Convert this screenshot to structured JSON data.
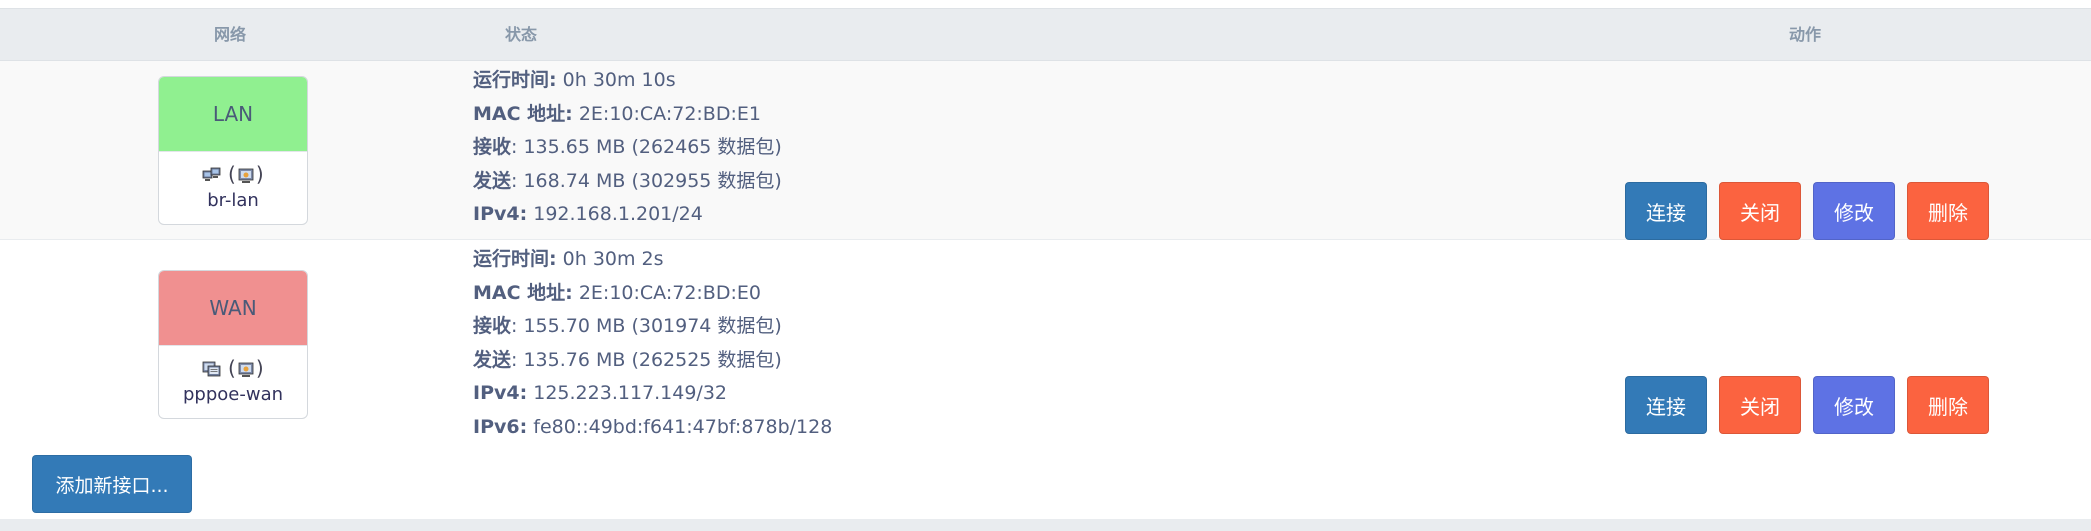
{
  "table": {
    "headers": {
      "network": "网络",
      "status": "状态",
      "actions": "动作"
    }
  },
  "interfaces": [
    {
      "name": "LAN",
      "device": "br-lan",
      "head_color": "#90f090",
      "device_icons": [
        "ethernet-bridge-icon",
        "wireless-icon"
      ],
      "status": {
        "uptime_label": "运行时间:",
        "uptime_value": "0h 30m 10s",
        "mac_label": "MAC 地址:",
        "mac_value": "2E:10:CA:72:BD:E1",
        "rx_label": "接收",
        "rx_value": ": 135.65 MB (262465 数据包)",
        "tx_label": "发送",
        "tx_value": ": 168.74 MB (302955 数据包)",
        "ipv4_label": "IPv4:",
        "ipv4_value": "192.168.1.201/24"
      },
      "buttons": {
        "connect": "连接",
        "stop": "关闭",
        "edit": "修改",
        "delete": "删除"
      }
    },
    {
      "name": "WAN",
      "device": "pppoe-wan",
      "head_color": "#f09090",
      "device_icons": [
        "tunnel-icon",
        "wireless-icon"
      ],
      "status": {
        "uptime_label": "运行时间:",
        "uptime_value": "0h 30m 2s",
        "mac_label": "MAC 地址:",
        "mac_value": "2E:10:CA:72:BD:E0",
        "rx_label": "接收",
        "rx_value": ": 155.70 MB (301974 数据包)",
        "tx_label": "发送",
        "tx_value": ": 135.76 MB (262525 数据包)",
        "ipv4_label": "IPv4:",
        "ipv4_value": "125.223.117.149/32",
        "ipv6_label": "IPv6:",
        "ipv6_value": "fe80::49bd:f641:47bf:878b/128"
      },
      "buttons": {
        "connect": "连接",
        "stop": "关闭",
        "edit": "修改",
        "delete": "删除"
      }
    }
  ],
  "add_interface_label": "添加新接口...",
  "colors": {
    "primary": "#337ab7",
    "danger": "#fb6340",
    "edit": "#5e72e4",
    "header_bg": "#e9ecef"
  }
}
